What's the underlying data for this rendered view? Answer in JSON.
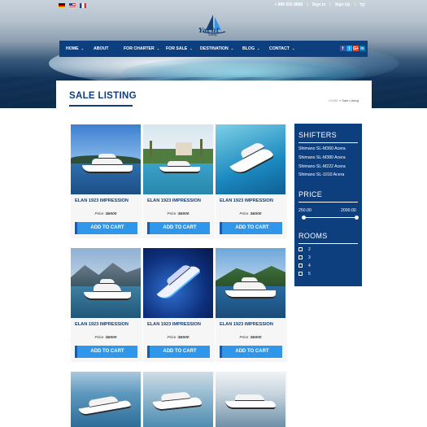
{
  "topbar": {
    "flags": [
      "flag-de-icon",
      "flag-us-icon",
      "flag-fr-icon"
    ],
    "phone": "+ 888 555 8888",
    "sign_in": "Sign In",
    "sign_up": "Sign Up",
    "separator": "|"
  },
  "logo": {
    "text": "Yacht",
    "sub": "Sailing"
  },
  "nav": {
    "items": [
      {
        "label": "HOME",
        "has_caret": true
      },
      {
        "label": "ABOUT",
        "has_caret": false
      },
      {
        "label": "FOR CHARTER",
        "has_caret": true
      },
      {
        "label": "FOR SALE",
        "has_caret": true
      },
      {
        "label": "DESTINATION",
        "has_caret": true
      },
      {
        "label": "BLOG",
        "has_caret": true
      },
      {
        "label": "CONTACT",
        "has_caret": true
      }
    ],
    "caret": "⌄",
    "socials": [
      "f",
      "t",
      "G+",
      "in"
    ]
  },
  "page": {
    "title": "SALE LISTING",
    "breadcrumb_home": "HOME",
    "breadcrumb_sep": "»",
    "breadcrumb_current": "Sale Listing"
  },
  "products": [
    {
      "name": "ELAN 1923 IMPRESSION",
      "price_label": "Price :",
      "price": "$5000",
      "button": "ADD TO CART"
    },
    {
      "name": "ELAN 1923 IMPRESSION",
      "price_label": "Price :",
      "price": "$5000",
      "button": "ADD TO CART"
    },
    {
      "name": "ELAN 1923 IMPRESSION",
      "price_label": "Price :",
      "price": "$5000",
      "button": "ADD TO CART"
    },
    {
      "name": "ELAN 1923 IMPRESSION",
      "price_label": "Price :",
      "price": "$5000",
      "button": "ADD TO CART"
    },
    {
      "name": "ELAN 1923 IMPRESSION",
      "price_label": "Price :",
      "price": "$5000",
      "button": "ADD TO CART"
    },
    {
      "name": "ELAN 1923 IMPRESSION",
      "price_label": "Price :",
      "price": "$5000",
      "button": "ADD TO CART"
    }
  ],
  "sidebar": {
    "shifters_title": "SHIFTERS",
    "shifters": [
      "Shimano SL-M360 Acera",
      "Shimano SL-M380 Acera",
      "Shimano SL-M222 Acera",
      "Shimano SL-1010 Acera"
    ],
    "price_title": "PRICE",
    "price_min": "250.00",
    "price_max": "2000.00",
    "rooms_title": "ROOMS",
    "rooms": [
      "2",
      "3",
      "4",
      "5"
    ]
  },
  "colors": {
    "primary": "#0d3e7e",
    "button": "#2f96ea",
    "button_edge": "#1a5aa8"
  }
}
